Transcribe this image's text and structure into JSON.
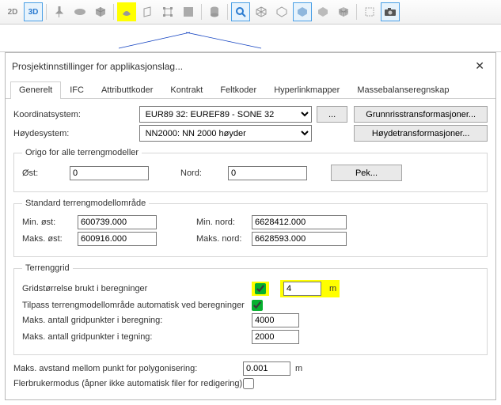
{
  "toolbar": {
    "btn2d": "2D",
    "btn3d": "3D"
  },
  "dialog": {
    "title": "Prosjektinnstillinger for applikasjonslag..."
  },
  "tabs": [
    "Generelt",
    "IFC",
    "Attributtkoder",
    "Kontrakt",
    "Feltkoder",
    "Hyperlinkmapper",
    "Massebalanseregnskap"
  ],
  "coord": {
    "label": "Koordinatsystem:",
    "value": "EUR89 32: EUREF89 - SONE 32",
    "browse": "...",
    "transform": "Grunnrisstransformasjoner..."
  },
  "height": {
    "label": "Høydesystem:",
    "value": "NN2000: NN 2000 høyder",
    "transform": "Høydetransformasjoner..."
  },
  "origo": {
    "legend": "Origo for alle terrengmodeller",
    "east_label": "Øst:",
    "east": "0",
    "north_label": "Nord:",
    "north": "0",
    "pick": "Pek..."
  },
  "std": {
    "legend": "Standard terrengmodellområde",
    "min_east_label": "Min. øst:",
    "min_east": "600739.000",
    "min_north_label": "Min. nord:",
    "min_north": "6628412.000",
    "max_east_label": "Maks. øst:",
    "max_east": "600916.000",
    "max_north_label": "Maks. nord:",
    "max_north": "6628593.000"
  },
  "grid": {
    "legend": "Terrenggrid",
    "gridsize_label": "Gridstørrelse brukt i beregninger",
    "gridsize": "4",
    "gridsize_unit": "m",
    "autofit_label": "Tilpass terrengmodellområde automatisk ved beregninger",
    "max_calc_label": "Maks. antall gridpunkter i beregning:",
    "max_calc": "4000",
    "max_draw_label": "Maks. antall gridpunkter i tegning:",
    "max_draw": "2000"
  },
  "poly": {
    "label": "Maks. avstand mellom punkt for polygonisering:",
    "value": "0.001",
    "unit": "m"
  },
  "multiuser": {
    "label": "Flerbrukermodus (åpner ikke automatisk filer for redigering)"
  }
}
